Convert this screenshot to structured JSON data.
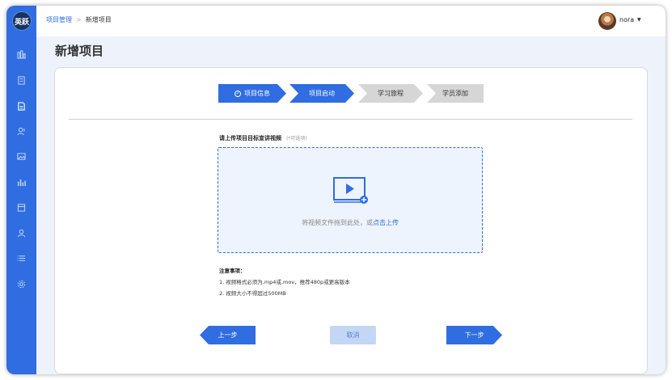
{
  "app": {
    "logo_text": "英跃"
  },
  "sidebar": {
    "items": [
      {
        "icon": "dashboard-icon"
      },
      {
        "icon": "document-icon"
      },
      {
        "icon": "project-icon"
      },
      {
        "icon": "users-icon"
      },
      {
        "icon": "image-icon"
      },
      {
        "icon": "chart-icon"
      },
      {
        "icon": "calendar-icon"
      },
      {
        "icon": "user-icon"
      },
      {
        "icon": "list-icon"
      },
      {
        "icon": "settings-icon"
      }
    ]
  },
  "breadcrumb": {
    "parent": "项目管理",
    "separator": ">",
    "current": "新增项目"
  },
  "user": {
    "name": "nora",
    "caret": "▼"
  },
  "page": {
    "title": "新增项目"
  },
  "steps": [
    {
      "label": "项目信息",
      "state": "done",
      "check": "✓"
    },
    {
      "label": "项目启动",
      "state": "active"
    },
    {
      "label": "学习旅程",
      "state": "inactive"
    },
    {
      "label": "学员添加",
      "state": "inactive"
    }
  ],
  "upload": {
    "label": "请上传项目目标宣讲视频",
    "optional": "(*可选项)",
    "drop_text": "将视频文件拖到此处，或",
    "drop_link": "点击上传"
  },
  "notes": {
    "title": "注意事项：",
    "items": [
      "1. 视频格式必须为.mp4或.mov，推荐480p或更高版本",
      "2. 视频大小不得超过500MB"
    ]
  },
  "buttons": {
    "prev": "上一步",
    "cancel": "取消",
    "next": "下一步"
  },
  "colors": {
    "primary": "#2f6de1",
    "inactive_step": "#d6d6d6",
    "cancel_bg": "#c3d6f6",
    "page_bg": "#edf2fb"
  }
}
